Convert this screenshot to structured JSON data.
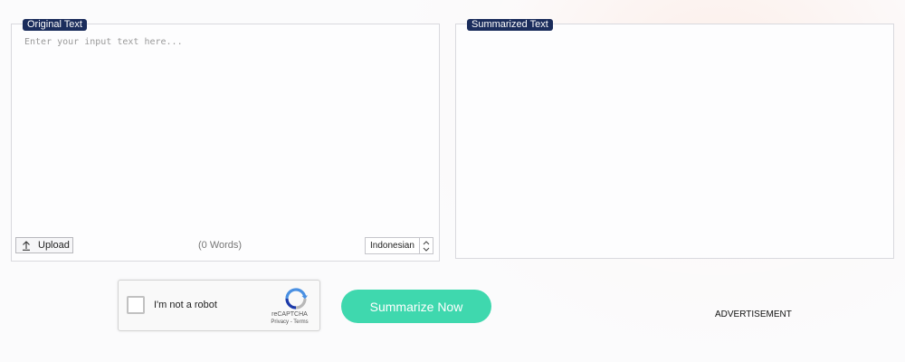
{
  "original_panel": {
    "tag": "Original Text",
    "placeholder": "Enter your input text here...",
    "upload_label": "Upload",
    "word_count": "(0 Words)",
    "language": "Indonesian"
  },
  "summary_panel": {
    "tag": "Summarized Text"
  },
  "captcha": {
    "label": "I'm not a robot",
    "brand": "reCAPTCHA",
    "privacy": "Privacy",
    "separator": " - ",
    "terms": "Terms"
  },
  "actions": {
    "summarize_label": "Summarize Now"
  },
  "ad": {
    "label": "ADVERTISEMENT"
  },
  "colors": {
    "tag_background": "#1b2d5c",
    "button_accent": "#3fd8ae"
  }
}
